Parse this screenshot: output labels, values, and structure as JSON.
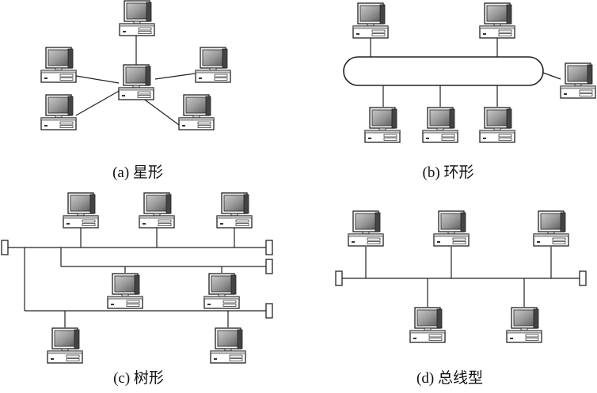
{
  "captions": {
    "star": "(a) 星形",
    "ring": "(b) 环形",
    "tree": "(c) 树形",
    "bus": "(d) 总线型"
  },
  "colors": {
    "line": "#222222",
    "monitor_screen": "#8a8a8a",
    "case_fill": "#ffffff"
  },
  "icons": {
    "computer": "desktop-computer-icon",
    "terminator": "bus-terminator-icon",
    "ring": "ring-backbone"
  }
}
